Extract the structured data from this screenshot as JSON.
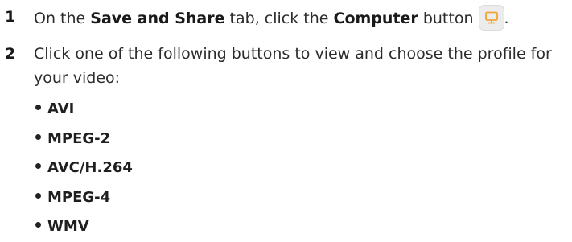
{
  "steps": [
    {
      "number": "1",
      "parts": {
        "before_tab": "On the ",
        "tab_name": "Save and Share",
        "between": " tab, click the ",
        "button_name": "Computer",
        "after_button": " button",
        "end": "."
      },
      "icon": "computer-monitor-icon",
      "icon_colors": {
        "background": "#ececec",
        "accent": "#f0a33a"
      }
    },
    {
      "number": "2",
      "text": "Click one of the following buttons to view and choose the profile for your video:",
      "options": [
        "AVI",
        "MPEG-2",
        "AVC/H.264",
        "MPEG-4",
        "WMV"
      ]
    }
  ]
}
